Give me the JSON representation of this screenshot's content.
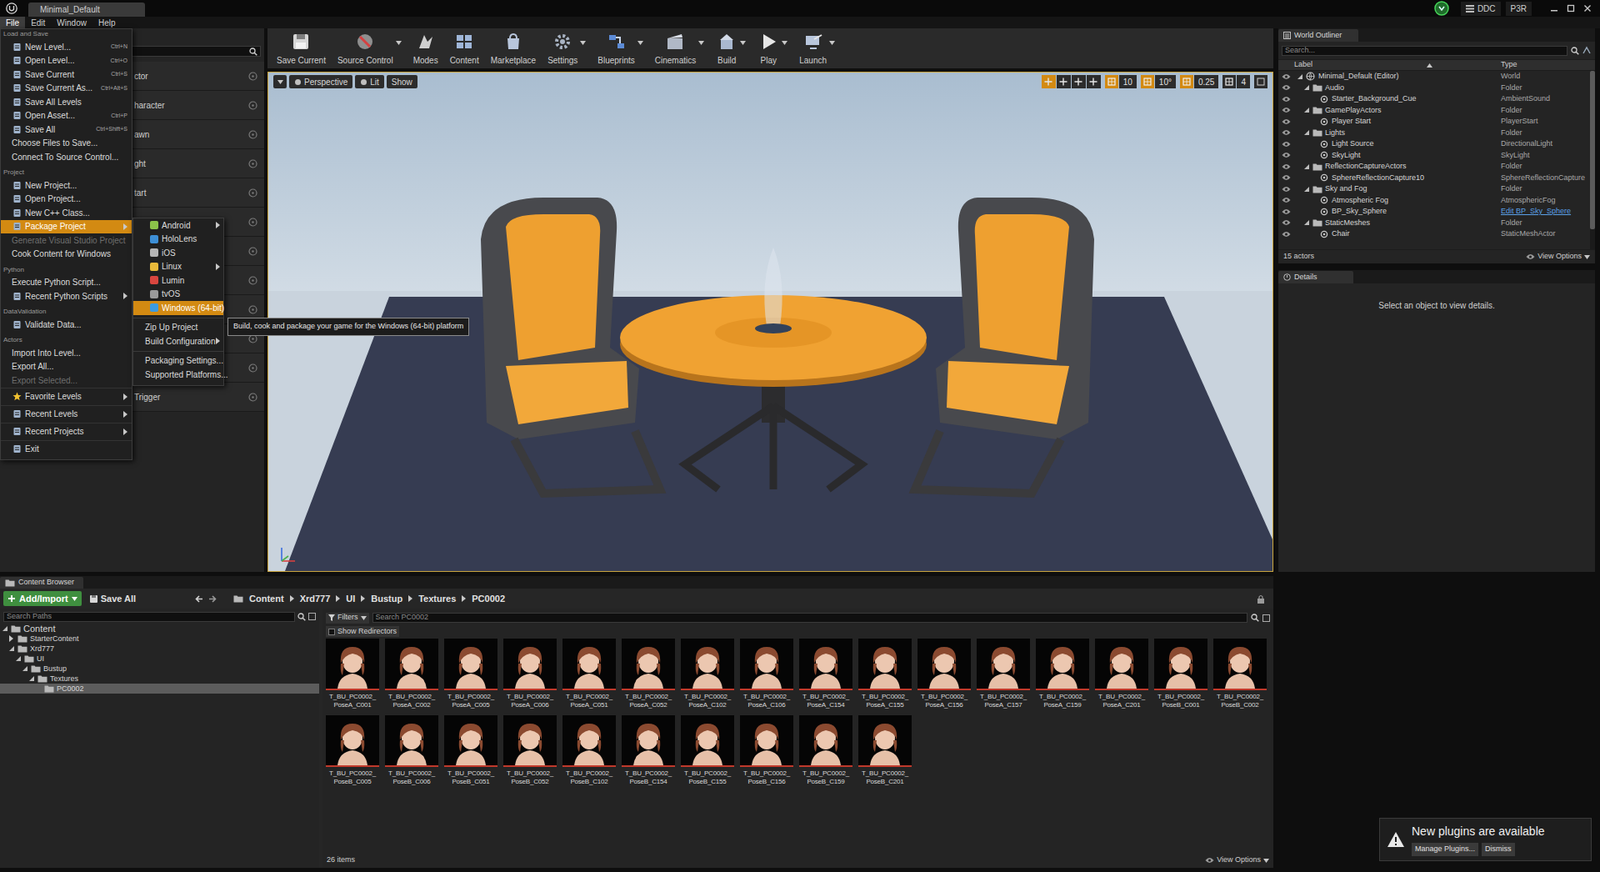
{
  "window": {
    "title": "Minimal_Default",
    "badges": [
      "DDC",
      "P3R"
    ]
  },
  "menubar": [
    {
      "label": "File",
      "selected": true
    },
    {
      "label": "Edit",
      "selected": false
    },
    {
      "label": "Window",
      "selected": false
    },
    {
      "label": "Help",
      "selected": false
    }
  ],
  "left_panel": {
    "items": [
      "ctor",
      "haracter",
      "awn",
      "ght",
      "tart"
    ],
    "last_item": "Trigger"
  },
  "toolbar": [
    {
      "label": "Save Current",
      "dropdown": false
    },
    {
      "label": "Source Control",
      "dropdown": true
    },
    {
      "label": "Modes",
      "dropdown": false
    },
    {
      "label": "Content",
      "dropdown": false
    },
    {
      "label": "Marketplace",
      "dropdown": false
    },
    {
      "label": "Settings",
      "dropdown": true
    },
    {
      "label": "Blueprints",
      "dropdown": true
    },
    {
      "label": "Cinematics",
      "dropdown": true
    },
    {
      "label": "Build",
      "dropdown": true
    },
    {
      "label": "Play",
      "dropdown": true
    },
    {
      "label": "Launch",
      "dropdown": true
    }
  ],
  "viewport": {
    "view": "Perspective",
    "lighting": "Lit",
    "show": "Show",
    "grid_snap": "10",
    "rotation_snap": "10°",
    "scale_snap": "0.25",
    "camera_speed": "4"
  },
  "file_menu": {
    "sections": [
      {
        "header": "Load and Save",
        "items": [
          {
            "label": "New Level...",
            "shortcut": "Ctrl+N",
            "kind": "icon",
            "has_submenu": false,
            "disabled": false,
            "selected": false
          },
          {
            "label": "Open Level...",
            "shortcut": "Ctrl+O",
            "kind": "icon",
            "has_submenu": false,
            "disabled": false,
            "selected": false
          },
          {
            "label": "Save Current",
            "shortcut": "Ctrl+S",
            "kind": "icon",
            "has_submenu": false,
            "disabled": false,
            "selected": false
          },
          {
            "label": "Save Current As...",
            "shortcut": "Ctrl+Alt+S",
            "kind": "icon",
            "has_submenu": false,
            "disabled": false,
            "selected": false
          },
          {
            "label": "Save All Levels",
            "kind": "icon",
            "has_submenu": false,
            "disabled": false,
            "selected": false
          },
          {
            "label": "Open Asset...",
            "shortcut": "Ctrl+P",
            "kind": "icon",
            "has_submenu": false,
            "disabled": false,
            "selected": false
          },
          {
            "label": "Save All",
            "shortcut": "Ctrl+Shift+S",
            "kind": "icon",
            "has_submenu": false,
            "disabled": false,
            "selected": false
          },
          {
            "label": "Choose Files to Save...",
            "kind": "plain",
            "has_submenu": false,
            "disabled": false,
            "selected": false
          },
          {
            "label": "Connect To Source Control...",
            "kind": "plain",
            "has_submenu": false,
            "disabled": false,
            "selected": false
          }
        ]
      },
      {
        "header": "Project",
        "items": [
          {
            "label": "New Project...",
            "kind": "icon",
            "has_submenu": false,
            "disabled": false,
            "selected": false
          },
          {
            "label": "Open Project...",
            "kind": "icon",
            "has_submenu": false,
            "disabled": false,
            "selected": false
          },
          {
            "label": "New C++ Class...",
            "kind": "icon",
            "has_submenu": false,
            "disabled": false,
            "selected": false
          },
          {
            "label": "Package Project",
            "kind": "icon",
            "has_submenu": true,
            "disabled": false,
            "selected": true
          },
          {
            "label": "Generate Visual Studio Project",
            "kind": "plain",
            "has_submenu": false,
            "disabled": true,
            "selected": false
          },
          {
            "label": "Cook Content for Windows",
            "kind": "plain",
            "has_submenu": false,
            "disabled": false,
            "selected": false
          }
        ]
      },
      {
        "header": "Python",
        "items": [
          {
            "label": "Execute Python Script...",
            "kind": "plain",
            "has_submenu": false,
            "disabled": false,
            "selected": false
          },
          {
            "label": "Recent Python Scripts",
            "kind": "icon",
            "has_submenu": true,
            "disabled": false,
            "selected": false
          }
        ]
      },
      {
        "header": "DataValidation",
        "items": [
          {
            "label": "Validate Data...",
            "kind": "icon",
            "has_submenu": false,
            "disabled": false,
            "selected": false
          }
        ]
      },
      {
        "header": "Actors",
        "items": [
          {
            "label": "Import Into Level...",
            "kind": "plain",
            "has_submenu": false,
            "disabled": false,
            "selected": false
          },
          {
            "label": "Export All...",
            "kind": "plain",
            "has_submenu": false,
            "disabled": false,
            "selected": false
          },
          {
            "label": "Export Selected...",
            "kind": "plain",
            "has_submenu": false,
            "disabled": true,
            "selected": false
          }
        ]
      },
      {
        "items": [
          {
            "label": "Favorite Levels",
            "kind": "star",
            "has_submenu": true,
            "disabled": false,
            "selected": false
          },
          {
            "label": "Recent Levels",
            "kind": "icon",
            "has_submenu": true,
            "disabled": false,
            "selected": false
          },
          {
            "label": "Recent Projects",
            "kind": "icon",
            "has_submenu": true,
            "disabled": false,
            "selected": false
          },
          {
            "label": "Exit",
            "kind": "icon",
            "has_submenu": false,
            "disabled": false,
            "selected": false
          }
        ]
      }
    ]
  },
  "package_submenu": {
    "sections": [
      {
        "items": [
          {
            "label": "Android",
            "kind": "platform",
            "color": "#8bc34a",
            "has_submenu": true,
            "selected": false
          },
          {
            "label": "HoloLens",
            "kind": "platform",
            "color": "#3d8fd6",
            "has_submenu": false,
            "selected": false
          },
          {
            "label": "iOS",
            "kind": "platform",
            "color": "#b5b5b5",
            "has_submenu": false,
            "selected": false
          },
          {
            "label": "Linux",
            "kind": "platform",
            "color": "#e8b93a",
            "has_submenu": true,
            "selected": false
          },
          {
            "label": "Lumin",
            "kind": "platform",
            "color": "#d9463f",
            "has_submenu": false,
            "selected": false
          },
          {
            "label": "tvOS",
            "kind": "platform",
            "color": "#9a9a9a",
            "has_submenu": false,
            "selected": false
          },
          {
            "label": "Windows (64-bit)",
            "kind": "platform",
            "color": "#3d9be0",
            "has_submenu": false,
            "selected": true
          }
        ]
      },
      {
        "items": [
          {
            "label": "Zip Up Project",
            "kind": "plain",
            "has_submenu": false,
            "selected": false
          },
          {
            "label": "Build Configuration",
            "kind": "plain",
            "has_submenu": true,
            "selected": false
          }
        ]
      },
      {
        "items": [
          {
            "label": "Packaging Settings...",
            "kind": "plain",
            "has_submenu": false,
            "selected": false
          },
          {
            "label": "Supported Platforms...",
            "kind": "plain",
            "has_submenu": false,
            "selected": false
          }
        ]
      }
    ]
  },
  "tooltip": "Build, cook and package your game for the Windows (64-bit) platform",
  "outliner": {
    "title": "World Outliner",
    "search_placeholder": "Search...",
    "columns": [
      "Label",
      "Type"
    ],
    "rows": [
      {
        "label": "Minimal_Default (Editor)",
        "type": "World",
        "depth": 0,
        "kind": "world",
        "expanded": true,
        "link": false
      },
      {
        "label": "Audio",
        "type": "Folder",
        "depth": 1,
        "kind": "folder",
        "expanded": true,
        "link": false
      },
      {
        "label": "Starter_Background_Cue",
        "type": "AmbientSound",
        "depth": 2,
        "kind": "actor",
        "expanded": false,
        "link": false
      },
      {
        "label": "GamePlayActors",
        "type": "Folder",
        "depth": 1,
        "kind": "folder",
        "expanded": true,
        "link": false
      },
      {
        "label": "Player Start",
        "type": "PlayerStart",
        "depth": 2,
        "kind": "actor",
        "expanded": false,
        "link": false
      },
      {
        "label": "Lights",
        "type": "Folder",
        "depth": 1,
        "kind": "folder",
        "expanded": true,
        "link": false
      },
      {
        "label": "Light Source",
        "type": "DirectionalLight",
        "depth": 2,
        "kind": "actor",
        "expanded": false,
        "link": false
      },
      {
        "label": "SkyLight",
        "type": "SkyLight",
        "depth": 2,
        "kind": "actor",
        "expanded": false,
        "link": false
      },
      {
        "label": "ReflectionCaptureActors",
        "type": "Folder",
        "depth": 1,
        "kind": "folder",
        "expanded": true,
        "link": false
      },
      {
        "label": "SphereReflectionCapture10",
        "type": "SphereReflectionCapture",
        "depth": 2,
        "kind": "actor",
        "expanded": false,
        "link": false
      },
      {
        "label": "Sky and Fog",
        "type": "Folder",
        "depth": 1,
        "kind": "folder",
        "expanded": true,
        "link": false
      },
      {
        "label": "Atmospheric Fog",
        "type": "AtmosphericFog",
        "depth": 2,
        "kind": "actor",
        "expanded": false,
        "link": false
      },
      {
        "label": "BP_Sky_Sphere",
        "type": "Edit BP_Sky_Sphere",
        "depth": 2,
        "kind": "actor",
        "expanded": false,
        "link": true
      },
      {
        "label": "StaticMeshes",
        "type": "Folder",
        "depth": 1,
        "kind": "folder",
        "expanded": true,
        "link": false
      },
      {
        "label": "Chair",
        "type": "StaticMeshActor",
        "depth": 2,
        "kind": "actor",
        "expanded": false,
        "link": false
      }
    ],
    "count": "15 actors",
    "view_options": "View Options"
  },
  "details": {
    "title": "Details",
    "empty": "Select an object to view details."
  },
  "content_browser": {
    "title": "Content Browser",
    "add_button": "Add/Import",
    "save_all": "Save All",
    "breadcrumb": [
      "Content",
      "Xrd777",
      "UI",
      "Bustup",
      "Textures",
      "PC0002"
    ],
    "path_search_placeholder": "Search Paths",
    "tree": [
      {
        "label": "Content",
        "depth": 0,
        "has_children": true,
        "expanded": true,
        "selected": false
      },
      {
        "label": "StarterContent",
        "depth": 1,
        "has_children": true,
        "expanded": false,
        "selected": false
      },
      {
        "label": "Xrd777",
        "depth": 1,
        "has_children": true,
        "expanded": true,
        "selected": false
      },
      {
        "label": "UI",
        "depth": 2,
        "has_children": true,
        "expanded": true,
        "selected": false
      },
      {
        "label": "Bustup",
        "depth": 3,
        "has_children": true,
        "expanded": true,
        "selected": false
      },
      {
        "label": "Textures",
        "depth": 4,
        "has_children": true,
        "expanded": true,
        "selected": false
      },
      {
        "label": "PC0002",
        "depth": 5,
        "has_children": false,
        "expanded": false,
        "selected": true
      }
    ],
    "filters": "Filters",
    "search_placeholder": "Search PC0002",
    "show_redirectors": {
      "label": "Show Redirectors",
      "checked": false
    },
    "assets": [
      {
        "lines": [
          "T_BU_PC0002_",
          "PoseA_C001"
        ]
      },
      {
        "lines": [
          "T_BU_PC0002_",
          "PoseA_C002"
        ]
      },
      {
        "lines": [
          "T_BU_PC0002_",
          "PoseA_C005"
        ]
      },
      {
        "lines": [
          "T_BU_PC0002_",
          "PoseA_C006"
        ]
      },
      {
        "lines": [
          "T_BU_PC0002_",
          "PoseA_C051"
        ]
      },
      {
        "lines": [
          "T_BU_PC0002_",
          "PoseA_C052"
        ]
      },
      {
        "lines": [
          "T_BU_PC0002_",
          "PoseA_C102"
        ]
      },
      {
        "lines": [
          "T_BU_PC0002_",
          "PoseA_C106"
        ]
      },
      {
        "lines": [
          "T_BU_PC0002_",
          "PoseA_C154"
        ]
      },
      {
        "lines": [
          "T_BU_PC0002_",
          "PoseA_C155"
        ]
      },
      {
        "lines": [
          "T_BU_PC0002_",
          "PoseA_C156"
        ]
      },
      {
        "lines": [
          "T_BU_PC0002_",
          "PoseA_C157"
        ]
      },
      {
        "lines": [
          "T_BU_PC0002_",
          "PoseA_C159"
        ]
      },
      {
        "lines": [
          "T_BU_PC0002_",
          "PoseA_C201"
        ]
      },
      {
        "lines": [
          "T_BU_PC0002_",
          "PoseB_C001"
        ]
      },
      {
        "lines": [
          "T_BU_PC0002_",
          "PoseB_C002"
        ]
      },
      {
        "lines": [
          "T_BU_PC0002_",
          "PoseB_C005"
        ]
      },
      {
        "lines": [
          "T_BU_PC0002_",
          "PoseB_C006"
        ]
      },
      {
        "lines": [
          "T_BU_PC0002_",
          "PoseB_C051"
        ]
      },
      {
        "lines": [
          "T_BU_PC0002_",
          "PoseB_C052"
        ]
      },
      {
        "lines": [
          "T_BU_PC0002_",
          "PoseB_C102"
        ]
      },
      {
        "lines": [
          "T_BU_PC0002_",
          "PoseB_C154"
        ]
      },
      {
        "lines": [
          "T_BU_PC0002_",
          "PoseB_C155"
        ]
      },
      {
        "lines": [
          "T_BU_PC0002_",
          "PoseB_C156"
        ]
      },
      {
        "lines": [
          "T_BU_PC0002_",
          "PoseB_C159"
        ]
      },
      {
        "lines": [
          "T_BU_PC0002_",
          "PoseB_C201"
        ]
      }
    ],
    "count": "26 items",
    "view_options": "View Options"
  },
  "notification": {
    "message": "New plugins are available",
    "buttons": [
      "Manage Plugins...",
      "Dismiss"
    ]
  }
}
